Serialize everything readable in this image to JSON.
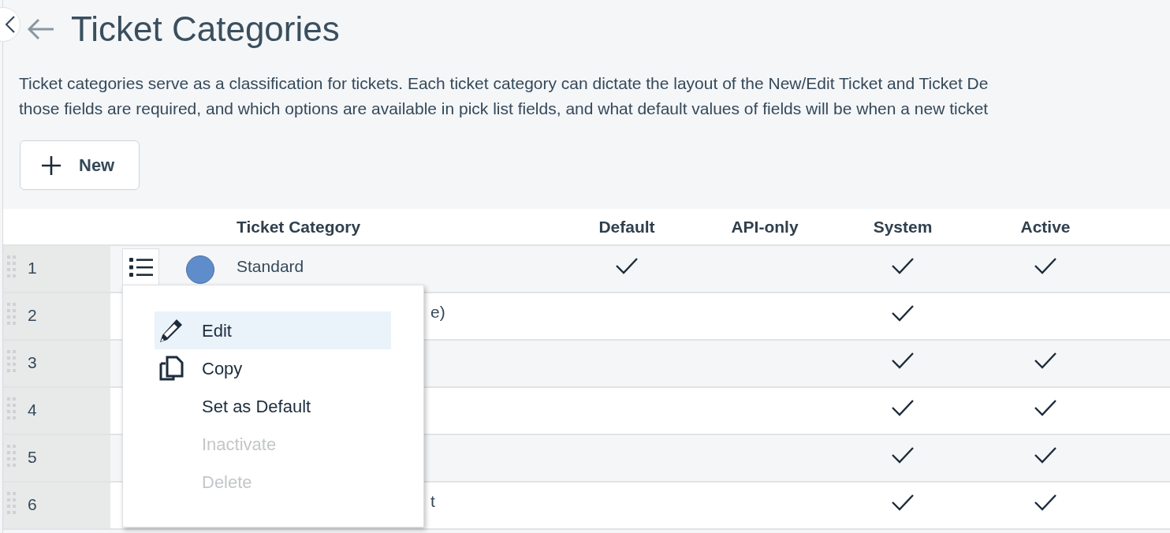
{
  "header": {
    "title": "Ticket Categories",
    "description": [
      "Ticket categories serve as a classification for tickets. Each ticket category can dictate the layout of the New/Edit Ticket and Ticket De",
      "those fields are required, and which options are available in pick list fields, and what default values of fields will be when a new ticket"
    ]
  },
  "new_button": {
    "label": "New"
  },
  "table": {
    "columns": [
      "Ticket Category",
      "Default",
      "API-only",
      "System",
      "Active"
    ],
    "rows": [
      {
        "number": "1",
        "category": "Standard",
        "covered": false,
        "color": "#5f8dcb",
        "default": true,
        "api_only": false,
        "system": true,
        "active": true
      },
      {
        "number": "2",
        "category": "e)",
        "covered": true,
        "default": false,
        "api_only": false,
        "system": true,
        "active": false
      },
      {
        "number": "3",
        "covered": true,
        "default": false,
        "api_only": false,
        "system": true,
        "active": true
      },
      {
        "number": "4",
        "covered": true,
        "default": false,
        "api_only": false,
        "system": true,
        "active": true
      },
      {
        "number": "5",
        "covered": true,
        "default": false,
        "api_only": false,
        "system": true,
        "active": true
      },
      {
        "number": "6",
        "category": "t",
        "covered": true,
        "default": false,
        "api_only": false,
        "system": true,
        "active": true
      }
    ]
  },
  "row_menu": {
    "items": [
      {
        "label": "Edit",
        "kind": "edit",
        "highlighted": true,
        "disabled": false
      },
      {
        "label": "Copy",
        "kind": "copy",
        "highlighted": false,
        "disabled": false
      },
      {
        "label": "Set as Default",
        "kind": "plain",
        "highlighted": false,
        "disabled": false
      },
      {
        "label": "Inactivate",
        "kind": "plain",
        "highlighted": false,
        "disabled": true
      },
      {
        "label": "Delete",
        "kind": "plain",
        "highlighted": false,
        "disabled": true
      }
    ]
  }
}
